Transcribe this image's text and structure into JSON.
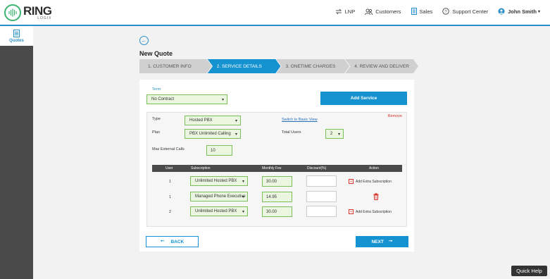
{
  "brand": {
    "name": "RING",
    "sub": "LOGIX"
  },
  "nav": {
    "lnp": "LNP",
    "customers": "Customers",
    "sales": "Sales",
    "support": "Support Center",
    "user": "John Smith"
  },
  "sidebar": {
    "quotes": "Quotes"
  },
  "page": {
    "title": "New Quote"
  },
  "steps": [
    "1. CUSTOMER INFO",
    "2. SERVICE DETAILS",
    "3. ONETIME CHARGES",
    "4. REVIEW AND DELIVER"
  ],
  "form": {
    "term_label": "Term",
    "term_value": "No Contract",
    "add_service": "Add Service",
    "remove": "Remove",
    "type_label": "Type",
    "type_value": "Hosted PBX",
    "switch_view": "Switch to Basic View",
    "plan_label": "Plan",
    "plan_value": "PBX Unlimited Calling",
    "total_users_label": "Total Users",
    "total_users_value": "2",
    "max_calls_label": "Max External Calls",
    "max_calls_value": "10"
  },
  "table": {
    "headers": [
      "User",
      "Subscription",
      "Monthly Fee",
      "Discount(%)",
      "Action"
    ],
    "rows": [
      {
        "user": "1",
        "subscription": "Unlimited Hosted PBX",
        "fee": "30.00",
        "discount": "",
        "action": "Add Extra Subscription"
      },
      {
        "user": "1",
        "subscription": "Managed Phone Executive",
        "fee": "14.95",
        "discount": "",
        "action": ""
      },
      {
        "user": "2",
        "subscription": "Unlimited Hosted PBX",
        "fee": "30.00",
        "discount": "",
        "action": "Add Extra Subscription"
      }
    ]
  },
  "buttons": {
    "back": "BACK",
    "next": "NEXT"
  },
  "quick_help": "Quick Help",
  "colors": {
    "accent": "#1592d0",
    "field_green": "#eaf6e0",
    "danger": "#d9342b"
  }
}
